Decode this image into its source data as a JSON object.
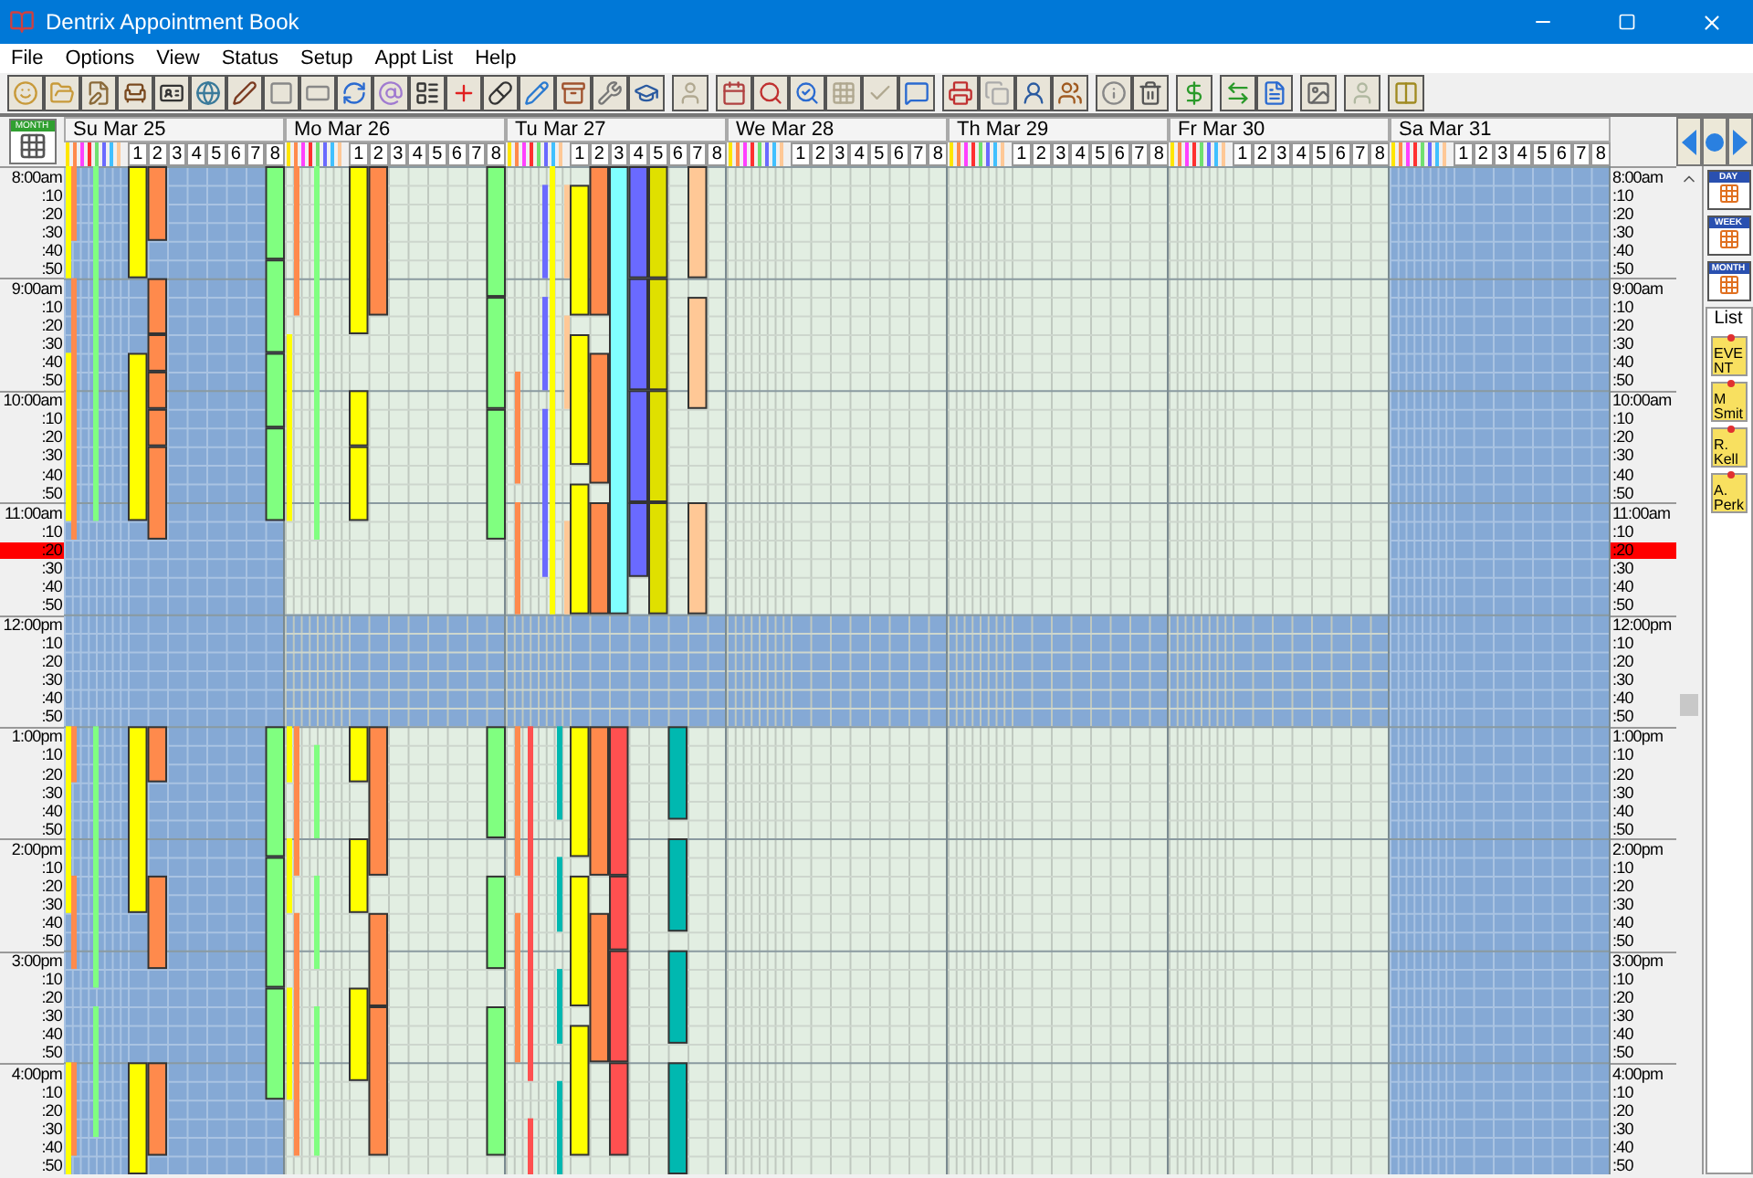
{
  "window": {
    "title": "Dentrix Appointment Book"
  },
  "menu": [
    "File",
    "Options",
    "View",
    "Status",
    "Setup",
    "Appt List",
    "Help"
  ],
  "view_button": {
    "label": "MONTH"
  },
  "days": [
    {
      "label": "Su Mar 25",
      "closed": true,
      "columns": [
        "1",
        "2",
        "3",
        "4",
        "5",
        "6",
        "7",
        "8"
      ]
    },
    {
      "label": "Mo Mar 26",
      "closed": false,
      "columns": [
        "1",
        "2",
        "3",
        "4",
        "5",
        "6",
        "7",
        "8"
      ]
    },
    {
      "label": "Tu Mar 27",
      "closed": false,
      "columns": [
        "1",
        "2",
        "3",
        "4",
        "5",
        "6",
        "7",
        "8"
      ]
    },
    {
      "label": "We Mar 28",
      "closed": false,
      "columns": [
        "1",
        "2",
        "3",
        "4",
        "5",
        "6",
        "7",
        "8"
      ]
    },
    {
      "label": "Th Mar 29",
      "closed": false,
      "columns": [
        "1",
        "2",
        "3",
        "4",
        "5",
        "6",
        "7",
        "8"
      ]
    },
    {
      "label": "Fr Mar 30",
      "closed": false,
      "columns": [
        "1",
        "2",
        "3",
        "4",
        "5",
        "6",
        "7",
        "8"
      ]
    },
    {
      "label": "Sa Mar 31",
      "closed": true,
      "columns": [
        "1",
        "2",
        "3",
        "4",
        "5",
        "6",
        "7",
        "8"
      ]
    }
  ],
  "time_labels_left": [
    {
      "label": "8:00am",
      "current": false
    },
    {
      "label": ":10",
      "current": false
    },
    {
      "label": ":20",
      "current": false
    },
    {
      "label": ":30",
      "current": false
    },
    {
      "label": ":40",
      "current": false
    },
    {
      "label": ":50",
      "current": false
    },
    {
      "label": "9:00am",
      "current": false
    },
    {
      "label": ":10",
      "current": false
    },
    {
      "label": ":20",
      "current": false
    },
    {
      "label": ":30",
      "current": false
    },
    {
      "label": ":40",
      "current": false
    },
    {
      "label": ":50",
      "current": false
    },
    {
      "label": "10:00am",
      "current": false
    },
    {
      "label": ":10",
      "current": false
    },
    {
      "label": ":20",
      "current": false
    },
    {
      "label": ":30",
      "current": false
    },
    {
      "label": ":40",
      "current": false
    },
    {
      "label": ":50",
      "current": false
    },
    {
      "label": "11:00am",
      "current": false
    },
    {
      "label": ":10",
      "current": false
    },
    {
      "label": ":20",
      "current": true
    },
    {
      "label": ":30",
      "current": false
    },
    {
      "label": ":40",
      "current": false
    },
    {
      "label": ":50",
      "current": false
    },
    {
      "label": "12:00pm",
      "current": false
    },
    {
      "label": ":10",
      "current": false
    },
    {
      "label": ":20",
      "current": false
    },
    {
      "label": ":30",
      "current": false
    },
    {
      "label": ":40",
      "current": false
    },
    {
      "label": ":50",
      "current": false
    },
    {
      "label": "1:00pm",
      "current": false
    },
    {
      "label": ":10",
      "current": false
    },
    {
      "label": ":20",
      "current": false
    },
    {
      "label": ":30",
      "current": false
    },
    {
      "label": ":40",
      "current": false
    },
    {
      "label": ":50",
      "current": false
    },
    {
      "label": "2:00pm",
      "current": false
    },
    {
      "label": ":10",
      "current": false
    },
    {
      "label": ":20",
      "current": false
    },
    {
      "label": ":30",
      "current": false
    },
    {
      "label": ":40",
      "current": false
    },
    {
      "label": ":50",
      "current": false
    },
    {
      "label": "3:00pm",
      "current": false
    },
    {
      "label": ":10",
      "current": false
    },
    {
      "label": ":20",
      "current": false
    },
    {
      "label": ":30",
      "current": false
    },
    {
      "label": ":40",
      "current": false
    },
    {
      "label": ":50",
      "current": false
    },
    {
      "label": "4:00pm",
      "current": false
    },
    {
      "label": ":10",
      "current": false
    },
    {
      "label": ":20",
      "current": false
    },
    {
      "label": ":30",
      "current": false
    },
    {
      "label": ":40",
      "current": false
    },
    {
      "label": ":50",
      "current": false
    }
  ],
  "time_labels_right": [
    {
      "label": "8:00am",
      "current": false
    },
    {
      "label": ":10",
      "current": false
    },
    {
      "label": ":20",
      "current": false
    },
    {
      "label": ":30",
      "current": false
    },
    {
      "label": ":40",
      "current": false
    },
    {
      "label": ":50",
      "current": false
    },
    {
      "label": "9:00am",
      "current": false
    },
    {
      "label": ":10",
      "current": false
    },
    {
      "label": ":20",
      "current": false
    },
    {
      "label": ":30",
      "current": false
    },
    {
      "label": ":40",
      "current": false
    },
    {
      "label": ":50",
      "current": false
    },
    {
      "label": "10:00am",
      "current": false
    },
    {
      "label": ":10",
      "current": false
    },
    {
      "label": ":20",
      "current": false
    },
    {
      "label": ":30",
      "current": false
    },
    {
      "label": ":40",
      "current": false
    },
    {
      "label": ":50",
      "current": false
    },
    {
      "label": "11:00am",
      "current": false
    },
    {
      "label": ":10",
      "current": false
    },
    {
      "label": ":20",
      "current": true
    },
    {
      "label": ":30",
      "current": false
    },
    {
      "label": ":40",
      "current": false
    },
    {
      "label": ":50",
      "current": false
    },
    {
      "label": "12:00pm",
      "current": false
    },
    {
      "label": ":10",
      "current": false
    },
    {
      "label": ":20",
      "current": false
    },
    {
      "label": ":30",
      "current": false
    },
    {
      "label": ":40",
      "current": false
    },
    {
      "label": ":50",
      "current": false
    },
    {
      "label": "1:00pm",
      "current": false
    },
    {
      "label": ":10",
      "current": false
    },
    {
      "label": ":20",
      "current": false
    },
    {
      "label": ":30",
      "current": false
    },
    {
      "label": ":40",
      "current": false
    },
    {
      "label": ":50",
      "current": false
    },
    {
      "label": "2:00pm",
      "current": false
    },
    {
      "label": ":10",
      "current": false
    },
    {
      "label": ":20",
      "current": false
    },
    {
      "label": ":30",
      "current": false
    },
    {
      "label": ":40",
      "current": false
    },
    {
      "label": ":50",
      "current": false
    },
    {
      "label": "3:00pm",
      "current": false
    },
    {
      "label": ":10",
      "current": false
    },
    {
      "label": ":20",
      "current": false
    },
    {
      "label": ":30",
      "current": false
    },
    {
      "label": ":40",
      "current": false
    },
    {
      "label": ":50",
      "current": false
    },
    {
      "label": "4:00pm",
      "current": false
    },
    {
      "label": ":10",
      "current": false
    },
    {
      "label": ":20",
      "current": false
    },
    {
      "label": ":30",
      "current": false
    },
    {
      "label": ":40",
      "current": false
    },
    {
      "label": ":50",
      "current": false
    }
  ],
  "nav": {
    "views": [
      "DAY",
      "WEEK",
      "MONTH"
    ],
    "list_label": "List",
    "notes": [
      "EVENT",
      "M Smit",
      "R. Kell",
      "A. Perk"
    ]
  }
}
